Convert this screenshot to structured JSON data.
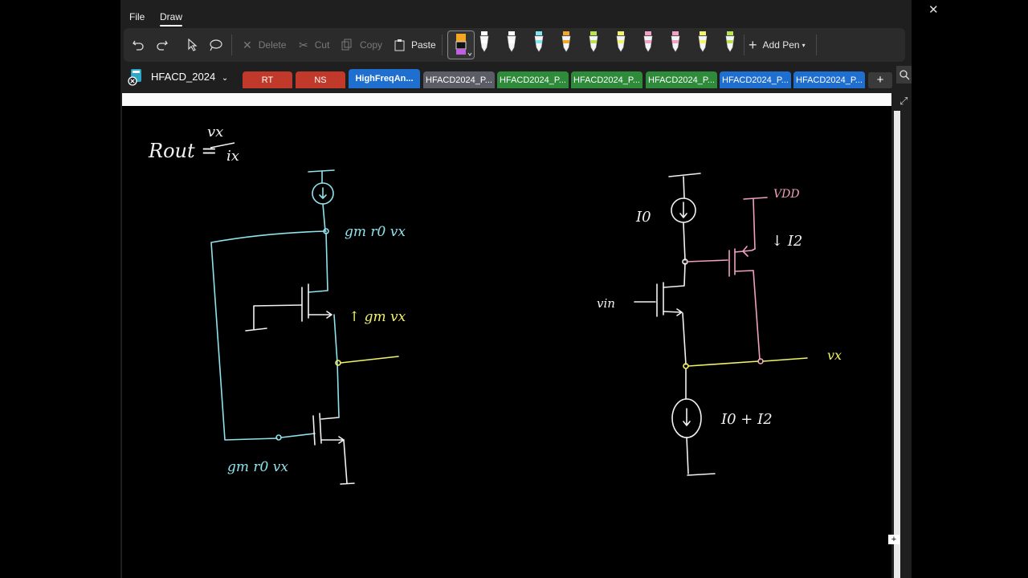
{
  "menu": {
    "file": "File",
    "draw": "Draw"
  },
  "toolbar": {
    "delete": "Delete",
    "cut": "Cut",
    "copy": "Copy",
    "paste": "Paste",
    "add_pen": "Add Pen"
  },
  "pens": [
    "#ffffff",
    "#ffffff",
    "#7fe6f0",
    "#f5a623",
    "#b7e34d",
    "#f3f36b",
    "#f2a0c8",
    "#f2a0c8",
    "#f3f36b",
    "#b7e34d"
  ],
  "notebook": {
    "name": "HFACD_2024"
  },
  "tabs": [
    {
      "label": "RT",
      "color": "#c0392b"
    },
    {
      "label": "NS",
      "color": "#c0392b"
    },
    {
      "label": "HighFreqAn...",
      "color": "#1f6fd1"
    },
    {
      "label": "HFACD2024_P...",
      "color": "#5c5c66"
    },
    {
      "label": "HFACD2024_P...",
      "color": "#2e8b3a"
    },
    {
      "label": "HFACD2024_P...",
      "color": "#2e8b3a"
    },
    {
      "label": "HFACD2024_P...",
      "color": "#2e8b3a"
    },
    {
      "label": "HFACD2024_P...",
      "color": "#1f6fd1"
    },
    {
      "label": "HFACD2024_P...",
      "color": "#1f6fd1"
    }
  ],
  "ink": {
    "rout_formula": "Rout = vx / ix",
    "left_label_top": "gm r0 vx",
    "left_label_mid": "↑ gm vx",
    "left_label_bottom": "gm r0 vx",
    "right_i0": "I0",
    "right_vdd": "VDD",
    "right_i2": "↓ I2",
    "right_vin": "vin",
    "right_vx": "vx",
    "right_i0_i2": "I0 + I2"
  }
}
